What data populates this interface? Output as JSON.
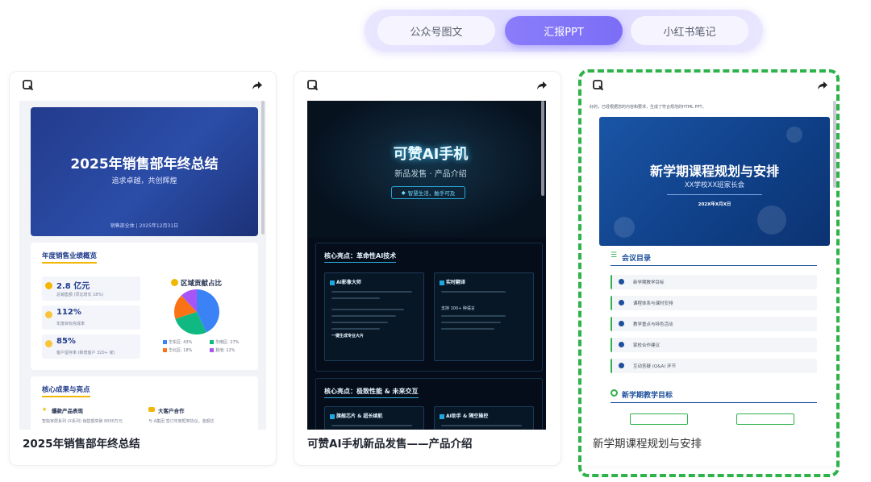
{
  "tabs": [
    {
      "label": "公众号图文",
      "active": false
    },
    {
      "label": "汇报PPT",
      "active": true
    },
    {
      "label": "小红书笔记",
      "active": false
    }
  ],
  "colors": {
    "accent": "#7b6ef6",
    "selected_border": "#2eb24a"
  },
  "cards": [
    {
      "title": "2025年销售部年终总结",
      "icons": [
        "preview-icon",
        "share-icon"
      ],
      "preview": {
        "slide_title": "2025年销售部年终总结",
        "slide_subtitle": "追求卓越，共创辉煌",
        "slide_footer": "销售部全体 | 2025年12月31日",
        "overview_heading": "年度销售业绩概览",
        "metrics": [
          {
            "value": "2.8 亿元",
            "desc": "总销售额 (同比增长 18%)"
          },
          {
            "value": "112%",
            "desc": "年度目标完成率"
          },
          {
            "value": "85%",
            "desc": "客户留存率 (新增客户 320+ 家)"
          }
        ],
        "pie_title": "区域贡献占比",
        "pie": [
          {
            "label": "华东区: 43%",
            "value": 43,
            "color": "#3b82f6"
          },
          {
            "label": "华南区: 27%",
            "value": 27,
            "color": "#10b981"
          },
          {
            "label": "华北区: 18%",
            "value": 18,
            "color": "#f97316"
          },
          {
            "label": "其他: 12%",
            "value": 12,
            "color": "#a855f7"
          }
        ],
        "achievements_heading": "核心成果与亮点",
        "achievements": [
          {
            "title": "爆款产品表现",
            "desc": "智能家居系列 (X系列) 销售额突破 8000万元"
          },
          {
            "title": "大客户合作",
            "desc": "与 A集团 签订年度框架协议，金额达"
          }
        ]
      }
    },
    {
      "title": "可赞AI手机新品发售——产品介绍",
      "icons": [
        "preview-icon",
        "share-icon"
      ],
      "preview": {
        "hero_title": "可赞AI手机",
        "hero_subtitle": "新品发售 · 产品介绍",
        "hero_pill": "智慧生活，触手可及",
        "section1_heading": "核心亮点：革命性AI技术",
        "box1_title": "AI影像大师",
        "box2_title": "实时翻译",
        "box2_bullet": "支持 100+ 种语言",
        "box1_bullet": "一键生成专业大片",
        "section2_heading": "核心亮点：极致性能 & 未来交互",
        "box3_title": "旗舰芯片 & 超长续航",
        "box4_title": "AI助手 & 隔空操控"
      }
    },
    {
      "title": "新学期课程规划与安排",
      "icons": [
        "preview-icon",
        "share-icon"
      ],
      "selected": true,
      "preview": {
        "intro": "好的，已经根据您的内容和要求，生成了符合规范的HTML PPT。",
        "hero_title": "新学期课程规划与安排",
        "hero_subtitle": "XX学校XX班家长会",
        "hero_date": "202X年X月X日",
        "agenda_heading": "会议目录",
        "agenda": [
          "新学期教学目标",
          "课程体系与课时安排",
          "教学重点与特色活动",
          "家校合作建议",
          "互动答疑 (Q&A) 环节"
        ],
        "goal_heading": "新学期教学目标"
      }
    }
  ]
}
